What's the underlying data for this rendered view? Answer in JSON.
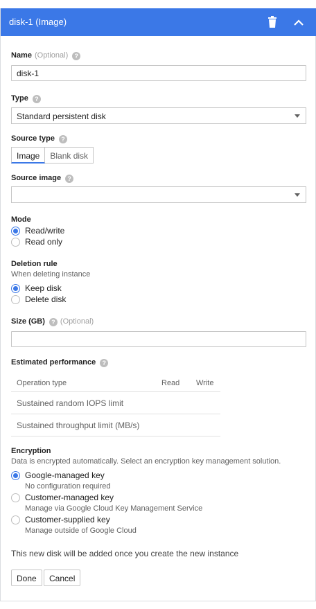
{
  "header": {
    "title": "disk-1 (Image)",
    "delete_icon": "trash-icon",
    "collapse_icon": "chevron-up-icon"
  },
  "name": {
    "label": "Name",
    "optional": "(Optional)",
    "value": "disk-1"
  },
  "type": {
    "label": "Type",
    "value": "Standard persistent disk"
  },
  "source_type": {
    "label": "Source type",
    "options": [
      "Image",
      "Blank disk"
    ],
    "selected": "Image"
  },
  "source_image": {
    "label": "Source image",
    "value": ""
  },
  "mode": {
    "label": "Mode",
    "options": [
      "Read/write",
      "Read only"
    ],
    "selected": "Read/write"
  },
  "deletion_rule": {
    "label": "Deletion rule",
    "description": "When deleting instance",
    "options": [
      "Keep disk",
      "Delete disk"
    ],
    "selected": "Keep disk"
  },
  "size": {
    "label": "Size (GB)",
    "optional": "(Optional)",
    "value": ""
  },
  "performance": {
    "label": "Estimated performance",
    "columns": [
      "Operation type",
      "Read",
      "Write"
    ],
    "rows": [
      [
        "Sustained random IOPS limit",
        "",
        ""
      ],
      [
        "Sustained throughput limit (MB/s)",
        "",
        ""
      ]
    ]
  },
  "encryption": {
    "label": "Encryption",
    "description": "Data is encrypted automatically. Select an encryption key management solution.",
    "options": [
      {
        "label": "Google-managed key",
        "sub": "No configuration required"
      },
      {
        "label": "Customer-managed key",
        "sub": "Manage via Google Cloud Key Management Service"
      },
      {
        "label": "Customer-supplied key",
        "sub": "Manage outside of Google Cloud"
      }
    ],
    "selected": "Google-managed key"
  },
  "note": "This new disk will be added once you create the new instance",
  "actions": {
    "done": "Done",
    "cancel": "Cancel"
  },
  "colors": {
    "header_bg": "#3b78e7",
    "accent": "#3b78e7"
  },
  "icons": {
    "help": "help-icon"
  }
}
